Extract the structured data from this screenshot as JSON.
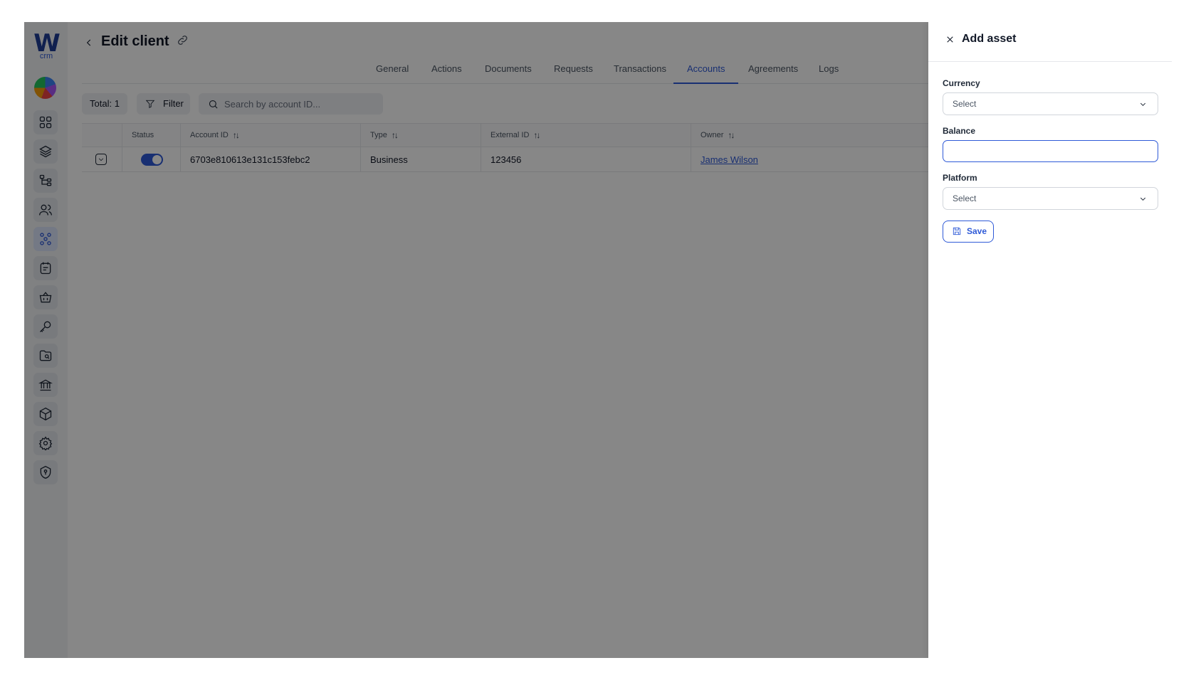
{
  "app": {
    "logo_mark": "W",
    "logo_sub": "crm"
  },
  "sidebar": {
    "items": [
      {
        "name": "dashboard-icon"
      },
      {
        "name": "layers-icon"
      },
      {
        "name": "hierarchy-icon"
      },
      {
        "name": "users-icon"
      },
      {
        "name": "clients-network-icon",
        "active": true
      },
      {
        "name": "notes-icon"
      },
      {
        "name": "basket-icon"
      },
      {
        "name": "key-icon"
      },
      {
        "name": "folder-search-icon"
      },
      {
        "name": "bank-icon"
      },
      {
        "name": "cube-icon"
      },
      {
        "name": "settings-icon"
      },
      {
        "name": "shield-icon"
      }
    ]
  },
  "header": {
    "title": "Edit client"
  },
  "tabs": [
    {
      "label": "General"
    },
    {
      "label": "Actions"
    },
    {
      "label": "Documents"
    },
    {
      "label": "Requests"
    },
    {
      "label": "Transactions"
    },
    {
      "label": "Accounts",
      "active": true
    },
    {
      "label": "Agreements"
    },
    {
      "label": "Logs"
    }
  ],
  "toolbar": {
    "total_label": "Total: 1",
    "filter_label": "Filter",
    "search_placeholder": "Search by account ID..."
  },
  "table": {
    "columns": [
      "Status",
      "Account ID",
      "Type",
      "External ID",
      "Owner"
    ],
    "rows": [
      {
        "status_enabled": true,
        "account_id": "6703e810613e131c153febc2",
        "type": "Business",
        "external_id": "123456",
        "owner": "James Wilson"
      }
    ]
  },
  "drawer": {
    "title": "Add asset",
    "currency_label": "Currency",
    "currency_value": "Select",
    "balance_label": "Balance",
    "balance_value": "",
    "platform_label": "Platform",
    "platform_value": "Select",
    "save_label": "Save"
  },
  "colors": {
    "accent": "#2f5ad7",
    "logo": "#1f3d96",
    "overlay": "rgba(0,0,0,0.47)"
  }
}
